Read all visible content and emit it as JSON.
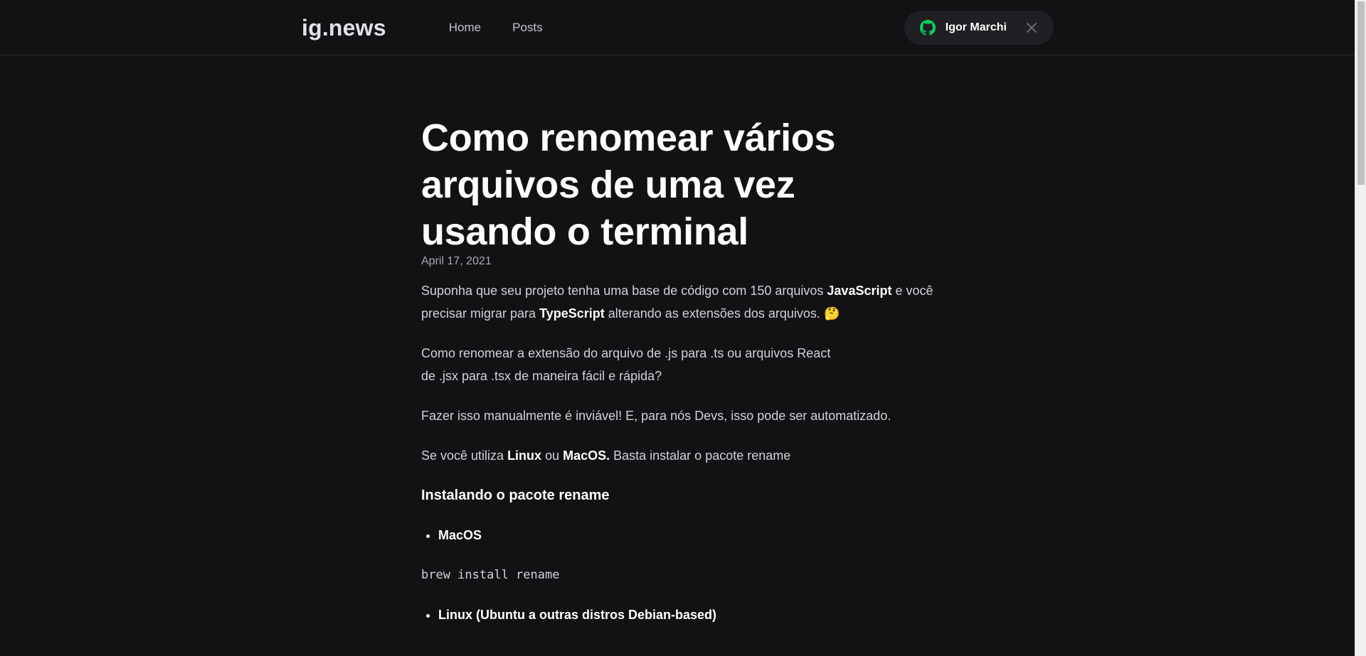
{
  "header": {
    "logo": "ig.news",
    "nav": [
      {
        "label": "Home"
      },
      {
        "label": "Posts"
      }
    ],
    "signin": {
      "user_name": "Igor Marchi",
      "icon": "github-icon",
      "close_icon": "close-icon",
      "icon_color": "#04d361"
    }
  },
  "post": {
    "title": "Como renomear vários arquivos de uma vez usando o terminal",
    "date": "April 17, 2021",
    "p1": {
      "a": "Suponha que seu projeto tenha uma base de código com 150 arquivos ",
      "b": "JavaScript",
      "c": " e você precisar migrar para ",
      "d": "TypeScript",
      "e": " alterando as extensões dos arquivos. 🤔"
    },
    "p2_line1": "Como renomear a extensão do arquivo de .js para .ts ou arquivos React",
    "p2_line2": "de .jsx para .tsx de maneira fácil e rápida?",
    "p3": "Fazer isso manualmente é inviável! E, para nós Devs, isso pode ser automatizado.",
    "p4": {
      "a": "Se você utiliza ",
      "b": "Linux",
      "c": " ou ",
      "d": "MacOS.",
      "e": " Basta instalar o pacote rename"
    },
    "h3": "Instalando o pacote rename",
    "list1": [
      "MacOS"
    ],
    "code1": "brew install rename",
    "list2": [
      "Linux (Ubuntu a outras distros Debian-based)"
    ]
  },
  "colors": {
    "background": "#121214",
    "text": "#e1e1e6",
    "accent": "#eba417"
  }
}
